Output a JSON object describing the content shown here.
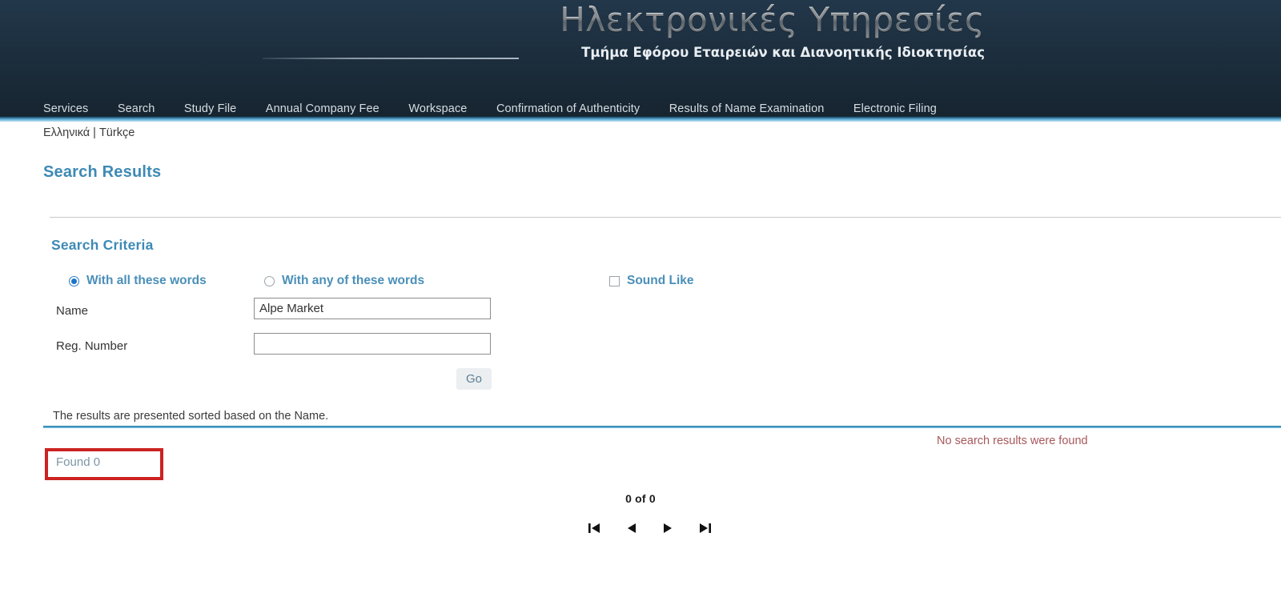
{
  "header": {
    "title": "Ηλεκτρονικές Υπηρεσίες",
    "subtitle": "Τμήμα Εφόρου Εταιρειών και Διανοητικής Ιδιοκτησίας",
    "nav": [
      {
        "label": "Services"
      },
      {
        "label": "Search"
      },
      {
        "label": "Study File"
      },
      {
        "label": "Annual Company Fee"
      },
      {
        "label": "Workspace"
      },
      {
        "label": "Confirmation of Authenticity"
      },
      {
        "label": "Results of Name Examination"
      },
      {
        "label": "Electronic Filing"
      }
    ]
  },
  "language_bar": {
    "greek": "Ελληνικά",
    "separator": "|",
    "turkish": "Türkçe"
  },
  "page": {
    "title": "Search Results",
    "section_title": "Search Criteria"
  },
  "criteria": {
    "option_all_label": "With all these words",
    "option_any_label": "With any of these words",
    "sound_like_label": "Sound Like",
    "option_all_selected": true,
    "option_any_selected": false,
    "sound_like_checked": false,
    "name_label": "Name",
    "name_value": "Alpe Market",
    "name_placeholder": "",
    "reg_number_label": "Reg. Number",
    "reg_number_value": "",
    "reg_number_placeholder": "",
    "go_label": "Go"
  },
  "results": {
    "sort_note": "The results are presented sorted based on the Name.",
    "found_label": "Found",
    "found_count": "0",
    "found_text": "Found  0",
    "no_results_message": "No search results were found",
    "pager_count": "0 of 0",
    "pager": {
      "first_label": "first-page",
      "previous_label": "previous-page",
      "next_label": "next-page",
      "last_label": "last-page"
    }
  },
  "colors": {
    "header_bg": "#1d2f3f",
    "accent_blue": "#3d8ab5",
    "divider_blue": "#3e97c4",
    "highlight_red": "#cc2222",
    "error_text": "#a8575a"
  }
}
